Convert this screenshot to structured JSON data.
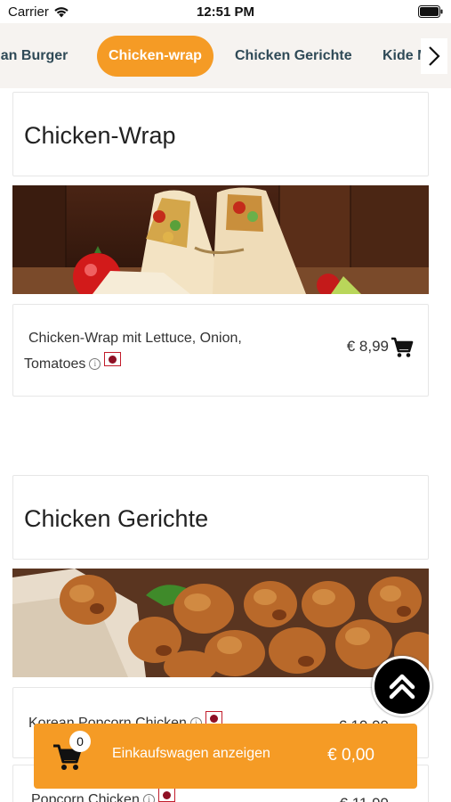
{
  "status_bar": {
    "carrier": "Carrier",
    "time": "12:51 PM"
  },
  "categories": {
    "items": [
      "han Burger",
      "Chicken-wrap",
      "Chicken Gerichte",
      "Kide M"
    ],
    "active": "Chicken-wrap",
    "next_icon": "chevron-right-icon"
  },
  "sections": [
    {
      "title": "Chicken-Wrap",
      "banner": "chicken-wrap-banner",
      "items": [
        {
          "name_line1": "Chicken-Wrap mit Lettuce, Onion,",
          "name_line2": "Tomatoes",
          "price": "€ 8,99"
        }
      ]
    },
    {
      "title": "Chicken Gerichte",
      "banner": "popcorn-chicken-banner",
      "items": [
        {
          "name": "Korean Popcorn Chicken",
          "price": "€ 10,99"
        },
        {
          "name": "Popcorn Chicken",
          "price": "€ 11,99"
        }
      ]
    }
  ],
  "scroll_top": {
    "icon": "double-chevron-up-icon"
  },
  "cart": {
    "count": "0",
    "label": "Einkaufswagen anzeigen",
    "total": "€ 0,00"
  },
  "colors": {
    "accent": "#f59b25",
    "category_text": "#2f4a57",
    "flag_red": "#8e1025"
  }
}
